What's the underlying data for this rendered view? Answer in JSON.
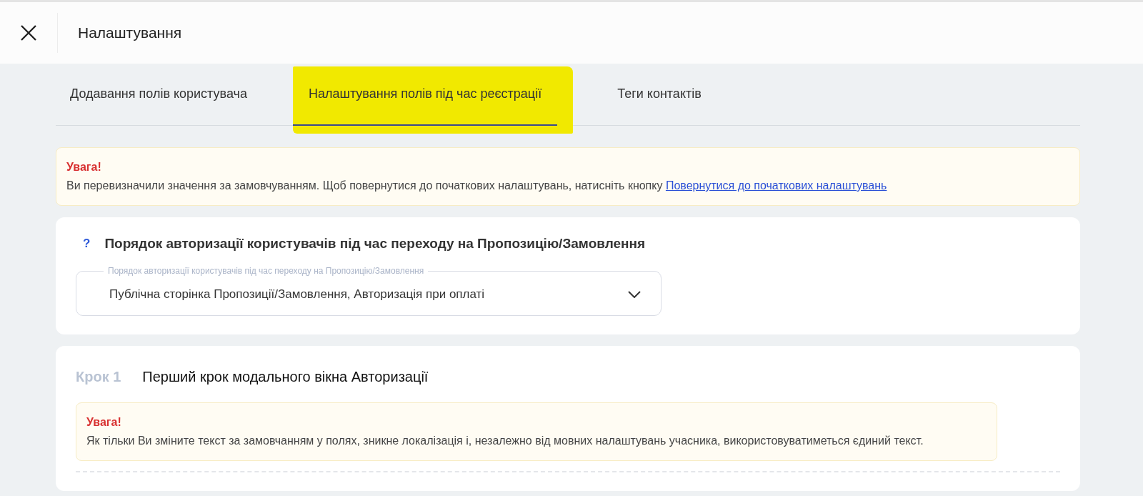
{
  "header": {
    "title": "Налаштування"
  },
  "tabs": [
    {
      "label": "Додавання полів користувача",
      "selected": false,
      "highlighted": false
    },
    {
      "label": "Налаштування полів під час реєстрації",
      "selected": true,
      "highlighted": true
    },
    {
      "label": "Теги контактів",
      "selected": false,
      "highlighted": false
    }
  ],
  "notice": {
    "title": "Увага!",
    "text": "Ви перевизначили значення за замовчуванням. Щоб повернутися до початкових налаштувань, натисніть кнопку",
    "link": "Повернутися до початкових налаштувань"
  },
  "auth_order": {
    "help": "?",
    "title": "Порядок авторизації користувачів під час переходу на Пропозицію/Замовлення",
    "select": {
      "label": "Порядок авторизації користувачів під час переходу на Пропозицію/Замовлення",
      "value": "Публічна сторінка Пропозиції/Замовлення, Авторизація при оплаті"
    }
  },
  "step": {
    "number": "Крок 1",
    "title": "Перший крок модального вікна Авторизації",
    "notice": {
      "title": "Увага!",
      "text": "Як тільки Ви зміните текст за замовчанням у полях, зникне локалізація і, незалежно від мовних налаштувань учасника, використовуватиметься єдиний текст."
    }
  }
}
